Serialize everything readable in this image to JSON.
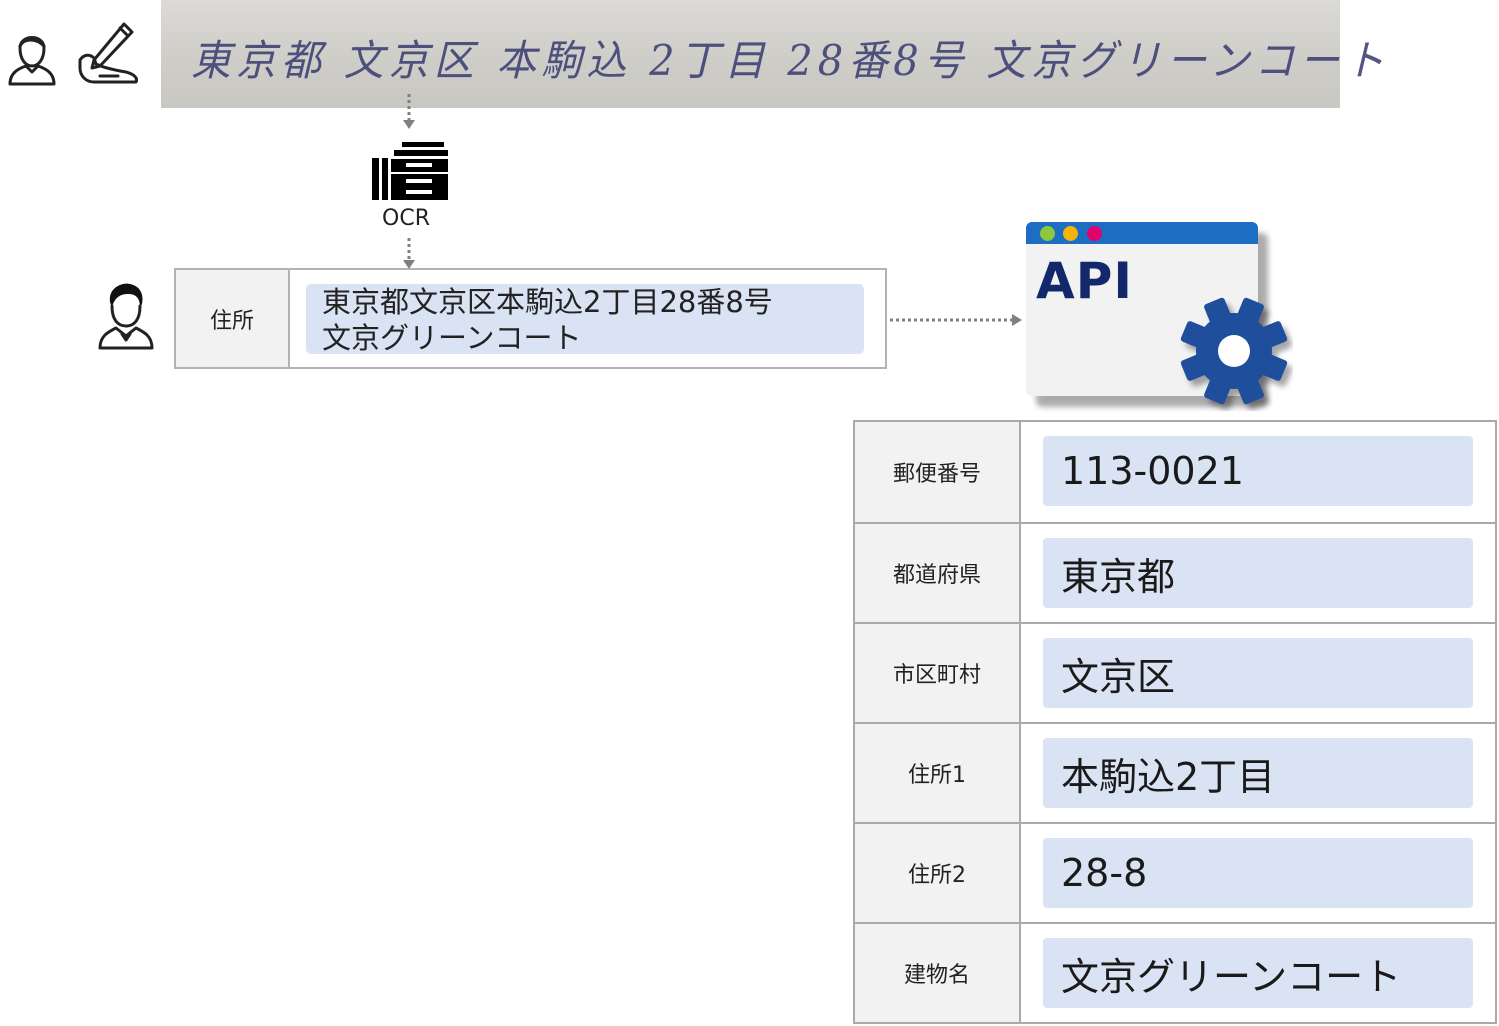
{
  "handwriting": {
    "text": "東京都 文京区 本駒込 2丁目 28番8号 文京グリーンコート"
  },
  "ocr": {
    "label": "OCR"
  },
  "address_input": {
    "label": "住所",
    "value_line1": "東京都文京区本駒込2丁目28番8号",
    "value_line2": "文京グリーンコート"
  },
  "api": {
    "title": "API",
    "dot_colors": [
      "#8dc63f",
      "#f4b400",
      "#e4006d"
    ],
    "bar_color": "#1d6ec2",
    "gear_color": "#1f4e9c"
  },
  "result": {
    "rows": [
      {
        "label": "郵便番号",
        "value": "113-0021"
      },
      {
        "label": "都道府県",
        "value": "東京都"
      },
      {
        "label": "市区町村",
        "value": "文京区"
      },
      {
        "label": "住所1",
        "value": "本駒込2丁目"
      },
      {
        "label": "住所2",
        "value": "28-8"
      },
      {
        "label": "建物名",
        "value": "文京グリーンコート"
      }
    ]
  },
  "colors": {
    "field_bg": "#dae3f3",
    "label_bg": "#f2f2f2",
    "border": "#a9a9a9"
  }
}
